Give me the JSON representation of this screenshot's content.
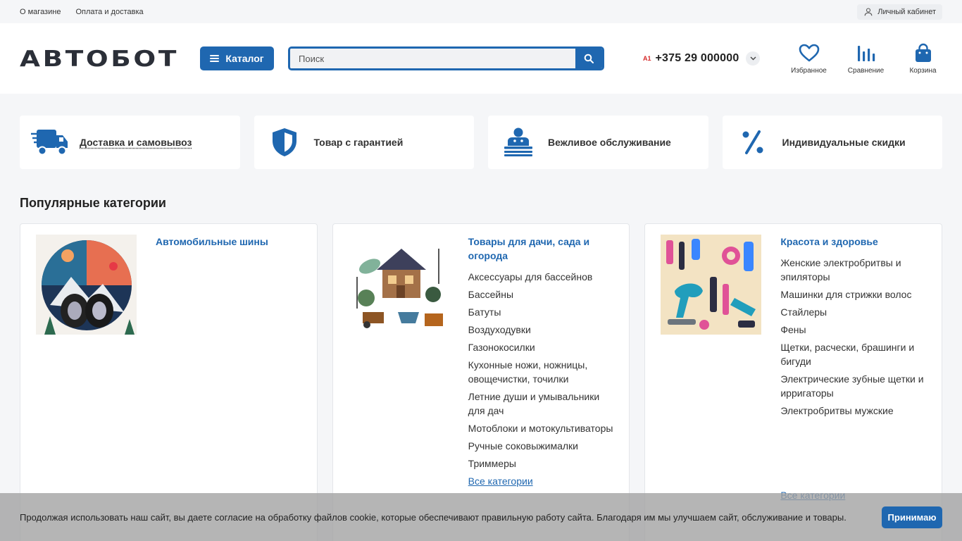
{
  "topbar": {
    "links": [
      "О магазине",
      "Оплата и доставка"
    ],
    "account_label": "Личный кабинет"
  },
  "header": {
    "logo_text": "АВТОБОТ",
    "catalog_label": "Каталог",
    "search_placeholder": "Поиск",
    "phone_operator": "A1",
    "phone_number": "+375 29 000000",
    "actions": [
      {
        "label": "Избранное",
        "icon": "heart-icon"
      },
      {
        "label": "Сравнение",
        "icon": "compare-icon"
      },
      {
        "label": "Корзина",
        "icon": "cart-icon"
      }
    ]
  },
  "features": [
    {
      "label": "Доставка и самовывоз",
      "icon": "delivery-truck-icon"
    },
    {
      "label": "Товар с гарантией",
      "icon": "shield-icon"
    },
    {
      "label": "Вежливое обслуживание",
      "icon": "service-icon"
    },
    {
      "label": "Индивидуальные скидки",
      "icon": "percent-icon"
    }
  ],
  "popular": {
    "title": "Популярные категории",
    "categories": [
      {
        "title": "Автомобильные шины",
        "items": [],
        "all_label": ""
      },
      {
        "title": "Товары для дачи, сада и огорода",
        "items": [
          "Аксессуары для бассейнов",
          "Бассейны",
          "Батуты",
          "Воздуходувки",
          "Газонокосилки",
          "Кухонные ножи, ножницы, овощечистки, точилки",
          "Летние души и умывальники для дач",
          "Мотоблоки и мотокультиваторы",
          "Ручные соковыжималки",
          "Триммеры"
        ],
        "all_label": "Все категории"
      },
      {
        "title": "Красота и здоровье",
        "items": [
          "Женские электробритвы и эпиляторы",
          "Машинки для стрижки волос",
          "Стайлеры",
          "Фены",
          "Щетки, расчески, брашинги и бигуди",
          "Электрические зубные щетки и ирригаторы",
          "Электробритвы мужские"
        ],
        "all_label": "Все категории"
      }
    ]
  },
  "cookie": {
    "text": "Продолжая использовать наш сайт, вы даете согласие на обработку файлов cookie, которые обеспечивают правильную работу сайта. Благодаря им мы улучшаем сайт, обслуживание и товары.",
    "accept_label": "Принимаю"
  },
  "colors": {
    "accent": "#1f67b0",
    "operator": "#d62a2a"
  }
}
